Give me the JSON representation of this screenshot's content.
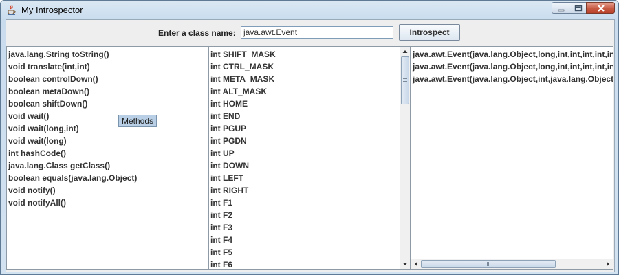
{
  "window": {
    "title": "My Introspector"
  },
  "toolbar": {
    "class_label": "Enter a class name:",
    "class_value": "java.awt.Event",
    "introspect_label": "Introspect"
  },
  "methods": [
    "java.lang.String toString()",
    "void translate(int,int)",
    "boolean controlDown()",
    "boolean metaDown()",
    "boolean shiftDown()",
    "void wait()",
    "void wait(long,int)",
    "void wait(long)",
    "int hashCode()",
    "java.lang.Class getClass()",
    "boolean equals(java.lang.Object)",
    "void notify()",
    "void notifyAll()"
  ],
  "tooltip": "Methods",
  "fields": [
    "int SHIFT_MASK",
    "int CTRL_MASK",
    "int META_MASK",
    "int ALT_MASK",
    "int HOME",
    "int END",
    "int PGUP",
    "int PGDN",
    "int UP",
    "int DOWN",
    "int LEFT",
    "int RIGHT",
    "int F1",
    "int F2",
    "int F3",
    "int F4",
    "int F5",
    "int F6"
  ],
  "constructors": [
    "java.awt.Event(java.lang.Object,long,int,int,int,int,int,",
    "java.awt.Event(java.lang.Object,long,int,int,int,int,int)",
    "java.awt.Event(java.lang.Object,int,java.lang.Object)"
  ]
}
